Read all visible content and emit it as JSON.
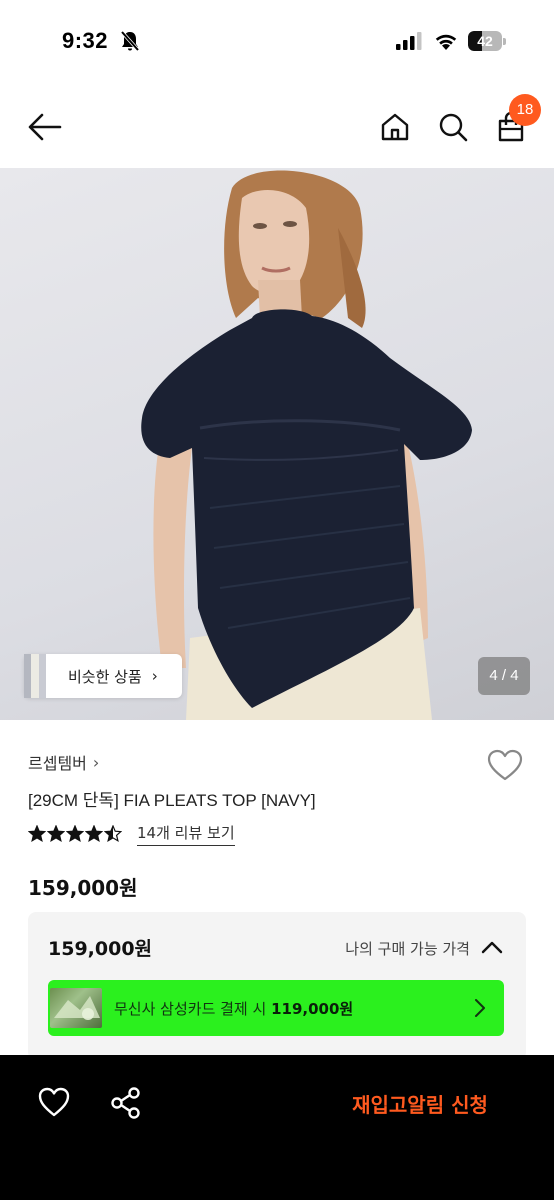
{
  "status_bar": {
    "time": "9:32",
    "battery": "42",
    "battery_level": 0.42,
    "icons": [
      "bell-off-icon",
      "signal-icon",
      "wifi-icon",
      "battery-icon"
    ]
  },
  "nav": {
    "icons": [
      "back-arrow-icon",
      "home-icon",
      "search-icon",
      "shopping-bag-icon"
    ],
    "cart_badge": "18",
    "badge_color": "#ff5a1f"
  },
  "gallery": {
    "similar_button": "비슷한 상품",
    "page_counter": "4 / 4"
  },
  "product": {
    "brand": "르셉템버",
    "name": "[29CM 단독] FIA PLEATS TOP [NAVY]",
    "rating": 4.5,
    "review_link": "14개 리뷰 보기",
    "price": "159,000원"
  },
  "price_box": {
    "price": "159,000원",
    "label": "나의 구매 가능 가격",
    "promo_prefix": "무신사 삼성카드 결제 시 ",
    "promo_price": "119,000원",
    "promo_color": "#2bf01e"
  },
  "bottom_bar": {
    "restock_button": "재입고알림 신청",
    "accent_color": "#ff5a1f",
    "icons": [
      "heart-icon",
      "share-icon"
    ]
  }
}
